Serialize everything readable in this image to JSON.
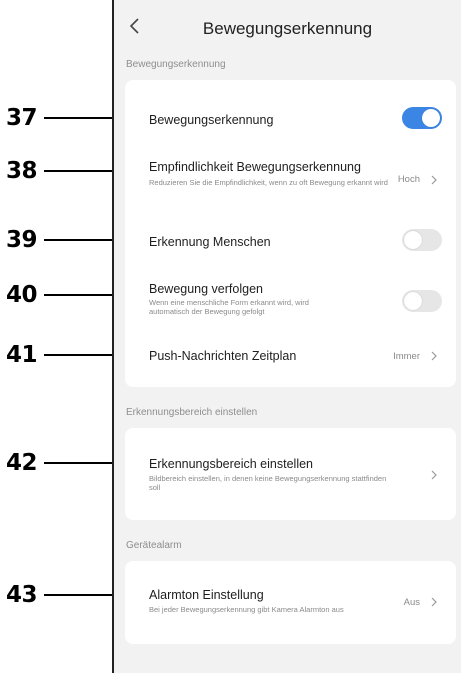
{
  "callouts": [
    "37",
    "38",
    "39",
    "40",
    "41",
    "42",
    "43"
  ],
  "header": {
    "title": "Bewegungserkennung"
  },
  "sections": [
    {
      "label": "Bewegungserkennung",
      "rows": [
        {
          "title": "Bewegungserkennung",
          "toggle": true
        },
        {
          "title": "Empfindlichkeit Bewegungserkennung",
          "subtitle": "Reduzieren Sie die Empfindlichkeit, wenn zu oft Bewegung erkannt wird",
          "value": "Hoch"
        },
        {
          "title": "Erkennung Menschen",
          "toggle": false
        },
        {
          "title": "Bewegung verfolgen",
          "subtitle": "Wenn eine menschliche Form erkannt wird, wird automatisch der Bewegung gefolgt",
          "toggle": false
        },
        {
          "title": "Push-Nachrichten Zeitplan",
          "value": "Immer"
        }
      ]
    },
    {
      "label": "Erkennungsbereich einstellen",
      "rows": [
        {
          "title": "Erkennungsbereich einstellen",
          "subtitle": "Bildbereich einstellen, in denen keine Bewegungserkennung stattfinden soll"
        }
      ]
    },
    {
      "label": "Gerätealarm",
      "rows": [
        {
          "title": "Alarmton Einstellung",
          "subtitle": "Bei jeder Bewegungserkennung gibt Kamera Alarmton aus",
          "value": "Aus"
        }
      ]
    }
  ],
  "colors": {
    "accent": "#3b86e4",
    "background": "#f2f2f2",
    "card": "#ffffff"
  },
  "icons": {
    "back": "chevron-left-icon",
    "disclosure": "chevron-right-icon"
  }
}
